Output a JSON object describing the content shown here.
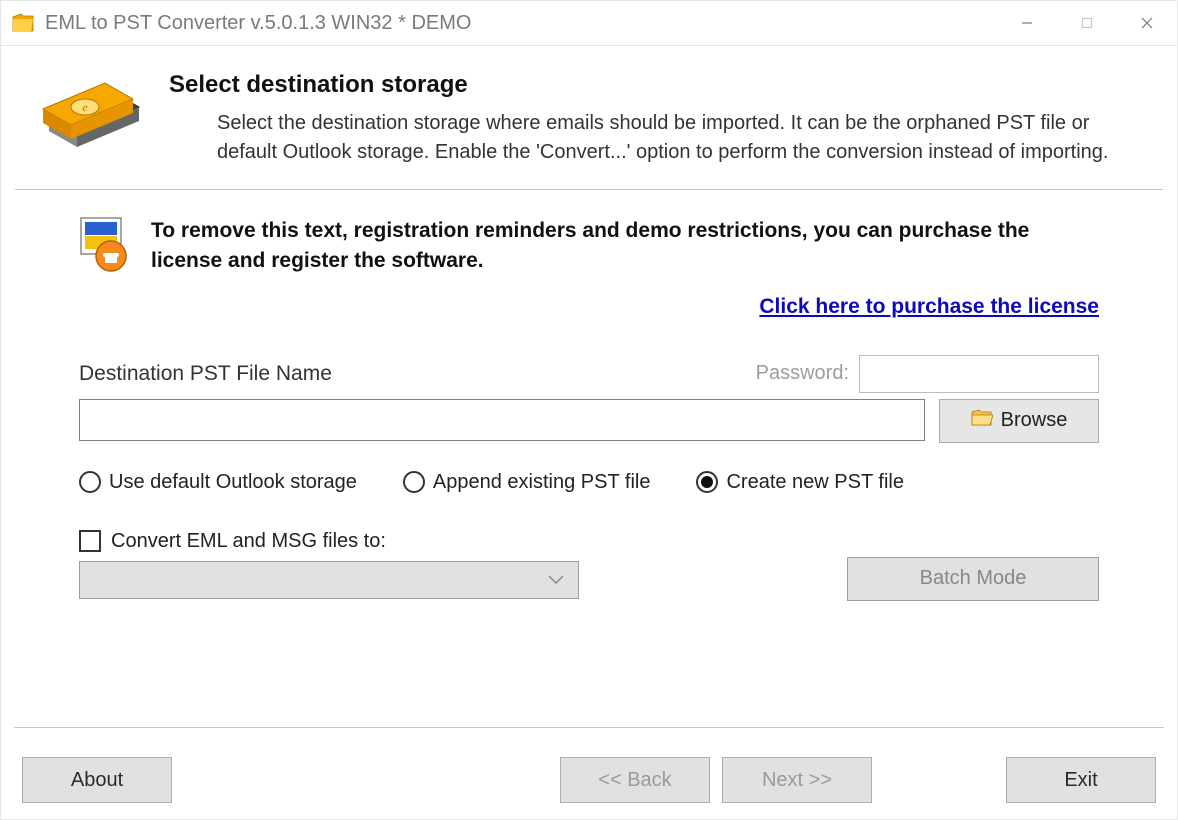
{
  "window": {
    "title": "EML to PST Converter v.5.0.1.3 WIN32 * DEMO"
  },
  "header": {
    "heading": "Select destination storage",
    "description": "Select the destination storage where emails should be imported. It can be the orphaned PST file or default Outlook storage. Enable the 'Convert...' option to perform the conversion instead of importing."
  },
  "demo": {
    "message": "To remove this text, registration reminders and demo restrictions, you can purchase the license and register the software.",
    "purchase_link": "Click here to purchase the license"
  },
  "form": {
    "dest_label": "Destination PST File Name",
    "password_label": "Password:",
    "password_value": "",
    "dest_path": "",
    "browse_label": "Browse",
    "radios": {
      "use_default": "Use default Outlook storage",
      "append_existing": "Append existing PST file",
      "create_new": "Create new PST file",
      "selected": "create_new"
    },
    "convert_checkbox_label": "Convert EML and MSG files to:",
    "convert_checked": false,
    "batch_mode_label": "Batch Mode"
  },
  "buttons": {
    "about": "About",
    "back": "<< Back",
    "next": "Next >>",
    "exit": "Exit"
  }
}
